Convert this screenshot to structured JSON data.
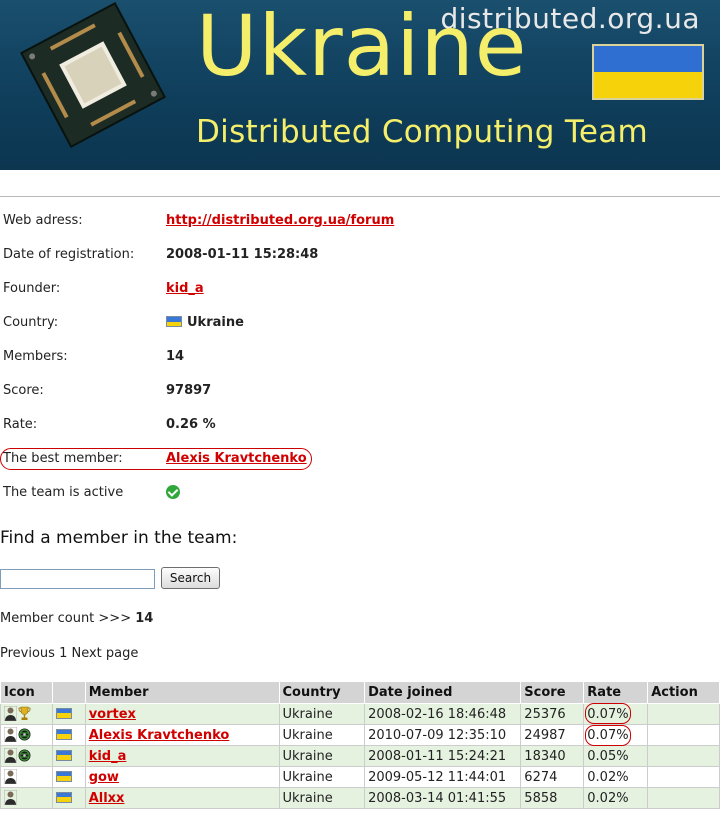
{
  "banner": {
    "site_url": "distributed.org.ua",
    "title": "Ukraine",
    "subtitle": "Distributed Computing Team"
  },
  "info": {
    "web_address_label": "Web adress:",
    "web_address_value": "http://distributed.org.ua/forum",
    "registration_label": "Date of registration:",
    "registration_value": "2008-01-11 15:28:48",
    "founder_label": "Founder:",
    "founder_value": "kid_a",
    "country_label": "Country:",
    "country_value": "Ukraine",
    "members_label": "Members:",
    "members_value": "14",
    "score_label": "Score:",
    "score_value": "97897",
    "rate_label": "Rate:",
    "rate_value": "0.26 %",
    "best_member_label": "The best member:",
    "best_member_value": "Alexis Kravtchenko",
    "active_label": "The team is active"
  },
  "find": {
    "title": "Find a member in the team:",
    "search_value": "",
    "search_button": "Search"
  },
  "member_count_label": "Member count >>>",
  "member_count_value": "14",
  "paging": "Previous 1 Next page",
  "table": {
    "headers": [
      "Icon",
      "",
      "Member",
      "Country",
      "Date joined",
      "Score",
      "Rate",
      "Action"
    ],
    "rows": [
      {
        "member": "vortex",
        "country": "Ukraine",
        "date": "2008-02-16 18:46:48",
        "score": "25376",
        "rate": "0.07%",
        "icons": [
          "person-icon",
          "trophy-icon"
        ]
      },
      {
        "member": "Alexis Kravtchenko",
        "country": "Ukraine",
        "date": "2010-07-09 12:35:10",
        "score": "24987",
        "rate": "0.07%",
        "icons": [
          "person-icon",
          "globe-icon"
        ]
      },
      {
        "member": "kid_a",
        "country": "Ukraine",
        "date": "2008-01-11 15:24:21",
        "score": "18340",
        "rate": "0.05%",
        "icons": [
          "person-icon",
          "globe-icon"
        ]
      },
      {
        "member": "gow",
        "country": "Ukraine",
        "date": "2009-05-12 11:44:01",
        "score": "6274",
        "rate": "0.02%",
        "icons": [
          "person-icon"
        ]
      },
      {
        "member": "Allxx",
        "country": "Ukraine",
        "date": "2008-03-14 01:41:55",
        "score": "5858",
        "rate": "0.02%",
        "icons": [
          "person-icon"
        ]
      }
    ]
  },
  "colors": {
    "banner_bg": "#0f3f5c",
    "banner_text": "#f4ee6a",
    "link": "#d00000",
    "row_even": "#e6f2e0",
    "header_bg": "#d4d4d4",
    "flag_blue": "#3a78d8",
    "flag_yellow": "#f5d20a"
  }
}
